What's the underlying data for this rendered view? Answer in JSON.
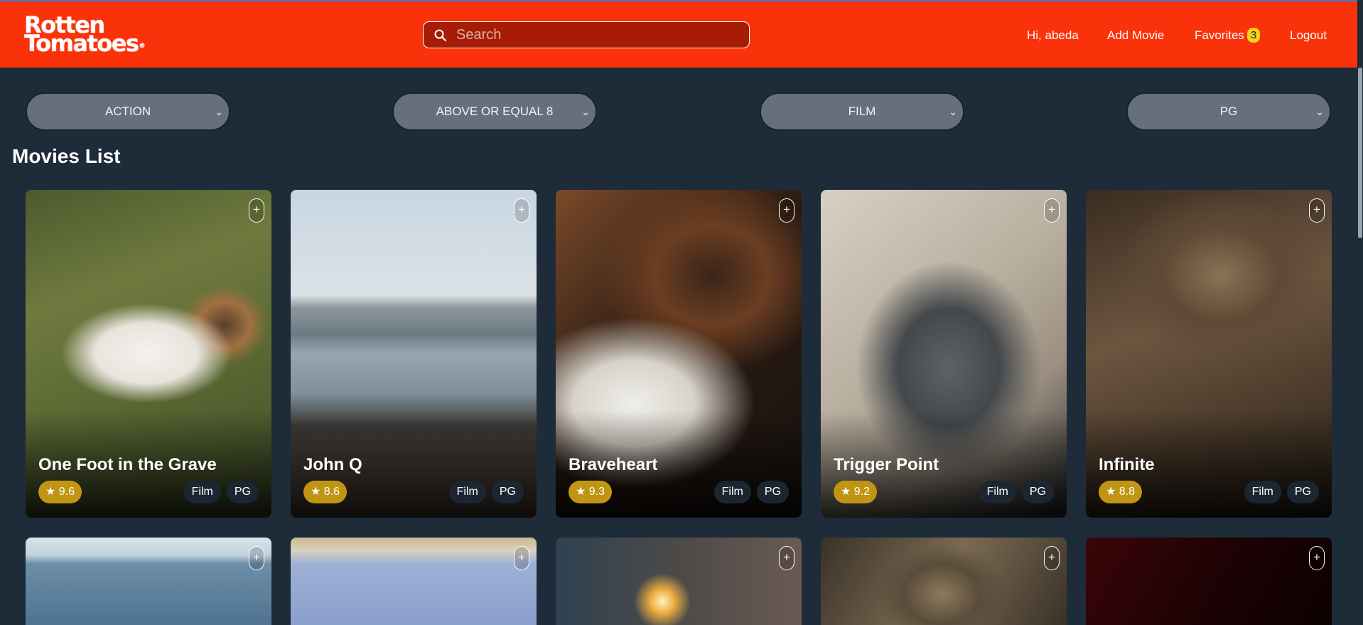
{
  "app": {
    "logo_line1": "Rotten",
    "logo_line2": "Tomatoes",
    "logo_mark": "®",
    "brand_color": "#fa320a"
  },
  "search": {
    "placeholder": "Search",
    "value": ""
  },
  "nav": {
    "greeting": "Hi, abeda",
    "add_movie": "Add Movie",
    "favorites": "Favorites",
    "favorites_count": "3",
    "logout": "Logout"
  },
  "filters": {
    "genre": "ACTION",
    "rating": "ABOVE OR EQUAL 8",
    "type": "FILM",
    "certification": "PG"
  },
  "section_title": "Movies List",
  "movies": [
    {
      "title": "One Foot in the Grave",
      "rating": "★ 9.6",
      "type": "Film",
      "cert": "PG",
      "add": "+"
    },
    {
      "title": "John Q",
      "rating": "★ 8.6",
      "type": "Film",
      "cert": "PG",
      "add": "+"
    },
    {
      "title": "Braveheart",
      "rating": "★ 9.3",
      "type": "Film",
      "cert": "PG",
      "add": "+"
    },
    {
      "title": "Trigger Point",
      "rating": "★ 9.2",
      "type": "Film",
      "cert": "PG",
      "add": "+"
    },
    {
      "title": "Infinite",
      "rating": "★ 8.8",
      "type": "Film",
      "cert": "PG",
      "add": "+"
    },
    {
      "add": "+"
    },
    {
      "add": "+"
    },
    {
      "add": "+"
    },
    {
      "add": "+"
    },
    {
      "add": "+"
    }
  ]
}
